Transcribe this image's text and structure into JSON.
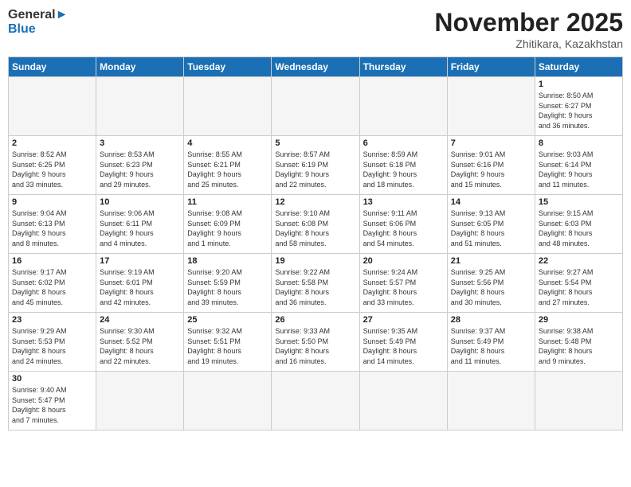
{
  "logo": {
    "text_general": "General",
    "text_blue": "Blue"
  },
  "header": {
    "month_title": "November 2025",
    "location": "Zhitikara, Kazakhstan"
  },
  "days_of_week": [
    "Sunday",
    "Monday",
    "Tuesday",
    "Wednesday",
    "Thursday",
    "Friday",
    "Saturday"
  ],
  "weeks": [
    [
      {
        "day": "",
        "info": ""
      },
      {
        "day": "",
        "info": ""
      },
      {
        "day": "",
        "info": ""
      },
      {
        "day": "",
        "info": ""
      },
      {
        "day": "",
        "info": ""
      },
      {
        "day": "",
        "info": ""
      },
      {
        "day": "1",
        "info": "Sunrise: 8:50 AM\nSunset: 6:27 PM\nDaylight: 9 hours\nand 36 minutes."
      }
    ],
    [
      {
        "day": "2",
        "info": "Sunrise: 8:52 AM\nSunset: 6:25 PM\nDaylight: 9 hours\nand 33 minutes."
      },
      {
        "day": "3",
        "info": "Sunrise: 8:53 AM\nSunset: 6:23 PM\nDaylight: 9 hours\nand 29 minutes."
      },
      {
        "day": "4",
        "info": "Sunrise: 8:55 AM\nSunset: 6:21 PM\nDaylight: 9 hours\nand 25 minutes."
      },
      {
        "day": "5",
        "info": "Sunrise: 8:57 AM\nSunset: 6:19 PM\nDaylight: 9 hours\nand 22 minutes."
      },
      {
        "day": "6",
        "info": "Sunrise: 8:59 AM\nSunset: 6:18 PM\nDaylight: 9 hours\nand 18 minutes."
      },
      {
        "day": "7",
        "info": "Sunrise: 9:01 AM\nSunset: 6:16 PM\nDaylight: 9 hours\nand 15 minutes."
      },
      {
        "day": "8",
        "info": "Sunrise: 9:03 AM\nSunset: 6:14 PM\nDaylight: 9 hours\nand 11 minutes."
      }
    ],
    [
      {
        "day": "9",
        "info": "Sunrise: 9:04 AM\nSunset: 6:13 PM\nDaylight: 9 hours\nand 8 minutes."
      },
      {
        "day": "10",
        "info": "Sunrise: 9:06 AM\nSunset: 6:11 PM\nDaylight: 9 hours\nand 4 minutes."
      },
      {
        "day": "11",
        "info": "Sunrise: 9:08 AM\nSunset: 6:09 PM\nDaylight: 9 hours\nand 1 minute."
      },
      {
        "day": "12",
        "info": "Sunrise: 9:10 AM\nSunset: 6:08 PM\nDaylight: 8 hours\nand 58 minutes."
      },
      {
        "day": "13",
        "info": "Sunrise: 9:11 AM\nSunset: 6:06 PM\nDaylight: 8 hours\nand 54 minutes."
      },
      {
        "day": "14",
        "info": "Sunrise: 9:13 AM\nSunset: 6:05 PM\nDaylight: 8 hours\nand 51 minutes."
      },
      {
        "day": "15",
        "info": "Sunrise: 9:15 AM\nSunset: 6:03 PM\nDaylight: 8 hours\nand 48 minutes."
      }
    ],
    [
      {
        "day": "16",
        "info": "Sunrise: 9:17 AM\nSunset: 6:02 PM\nDaylight: 8 hours\nand 45 minutes."
      },
      {
        "day": "17",
        "info": "Sunrise: 9:19 AM\nSunset: 6:01 PM\nDaylight: 8 hours\nand 42 minutes."
      },
      {
        "day": "18",
        "info": "Sunrise: 9:20 AM\nSunset: 5:59 PM\nDaylight: 8 hours\nand 39 minutes."
      },
      {
        "day": "19",
        "info": "Sunrise: 9:22 AM\nSunset: 5:58 PM\nDaylight: 8 hours\nand 36 minutes."
      },
      {
        "day": "20",
        "info": "Sunrise: 9:24 AM\nSunset: 5:57 PM\nDaylight: 8 hours\nand 33 minutes."
      },
      {
        "day": "21",
        "info": "Sunrise: 9:25 AM\nSunset: 5:56 PM\nDaylight: 8 hours\nand 30 minutes."
      },
      {
        "day": "22",
        "info": "Sunrise: 9:27 AM\nSunset: 5:54 PM\nDaylight: 8 hours\nand 27 minutes."
      }
    ],
    [
      {
        "day": "23",
        "info": "Sunrise: 9:29 AM\nSunset: 5:53 PM\nDaylight: 8 hours\nand 24 minutes."
      },
      {
        "day": "24",
        "info": "Sunrise: 9:30 AM\nSunset: 5:52 PM\nDaylight: 8 hours\nand 22 minutes."
      },
      {
        "day": "25",
        "info": "Sunrise: 9:32 AM\nSunset: 5:51 PM\nDaylight: 8 hours\nand 19 minutes."
      },
      {
        "day": "26",
        "info": "Sunrise: 9:33 AM\nSunset: 5:50 PM\nDaylight: 8 hours\nand 16 minutes."
      },
      {
        "day": "27",
        "info": "Sunrise: 9:35 AM\nSunset: 5:49 PM\nDaylight: 8 hours\nand 14 minutes."
      },
      {
        "day": "28",
        "info": "Sunrise: 9:37 AM\nSunset: 5:49 PM\nDaylight: 8 hours\nand 11 minutes."
      },
      {
        "day": "29",
        "info": "Sunrise: 9:38 AM\nSunset: 5:48 PM\nDaylight: 8 hours\nand 9 minutes."
      }
    ],
    [
      {
        "day": "30",
        "info": "Sunrise: 9:40 AM\nSunset: 5:47 PM\nDaylight: 8 hours\nand 7 minutes."
      },
      {
        "day": "",
        "info": ""
      },
      {
        "day": "",
        "info": ""
      },
      {
        "day": "",
        "info": ""
      },
      {
        "day": "",
        "info": ""
      },
      {
        "day": "",
        "info": ""
      },
      {
        "day": "",
        "info": ""
      }
    ]
  ]
}
